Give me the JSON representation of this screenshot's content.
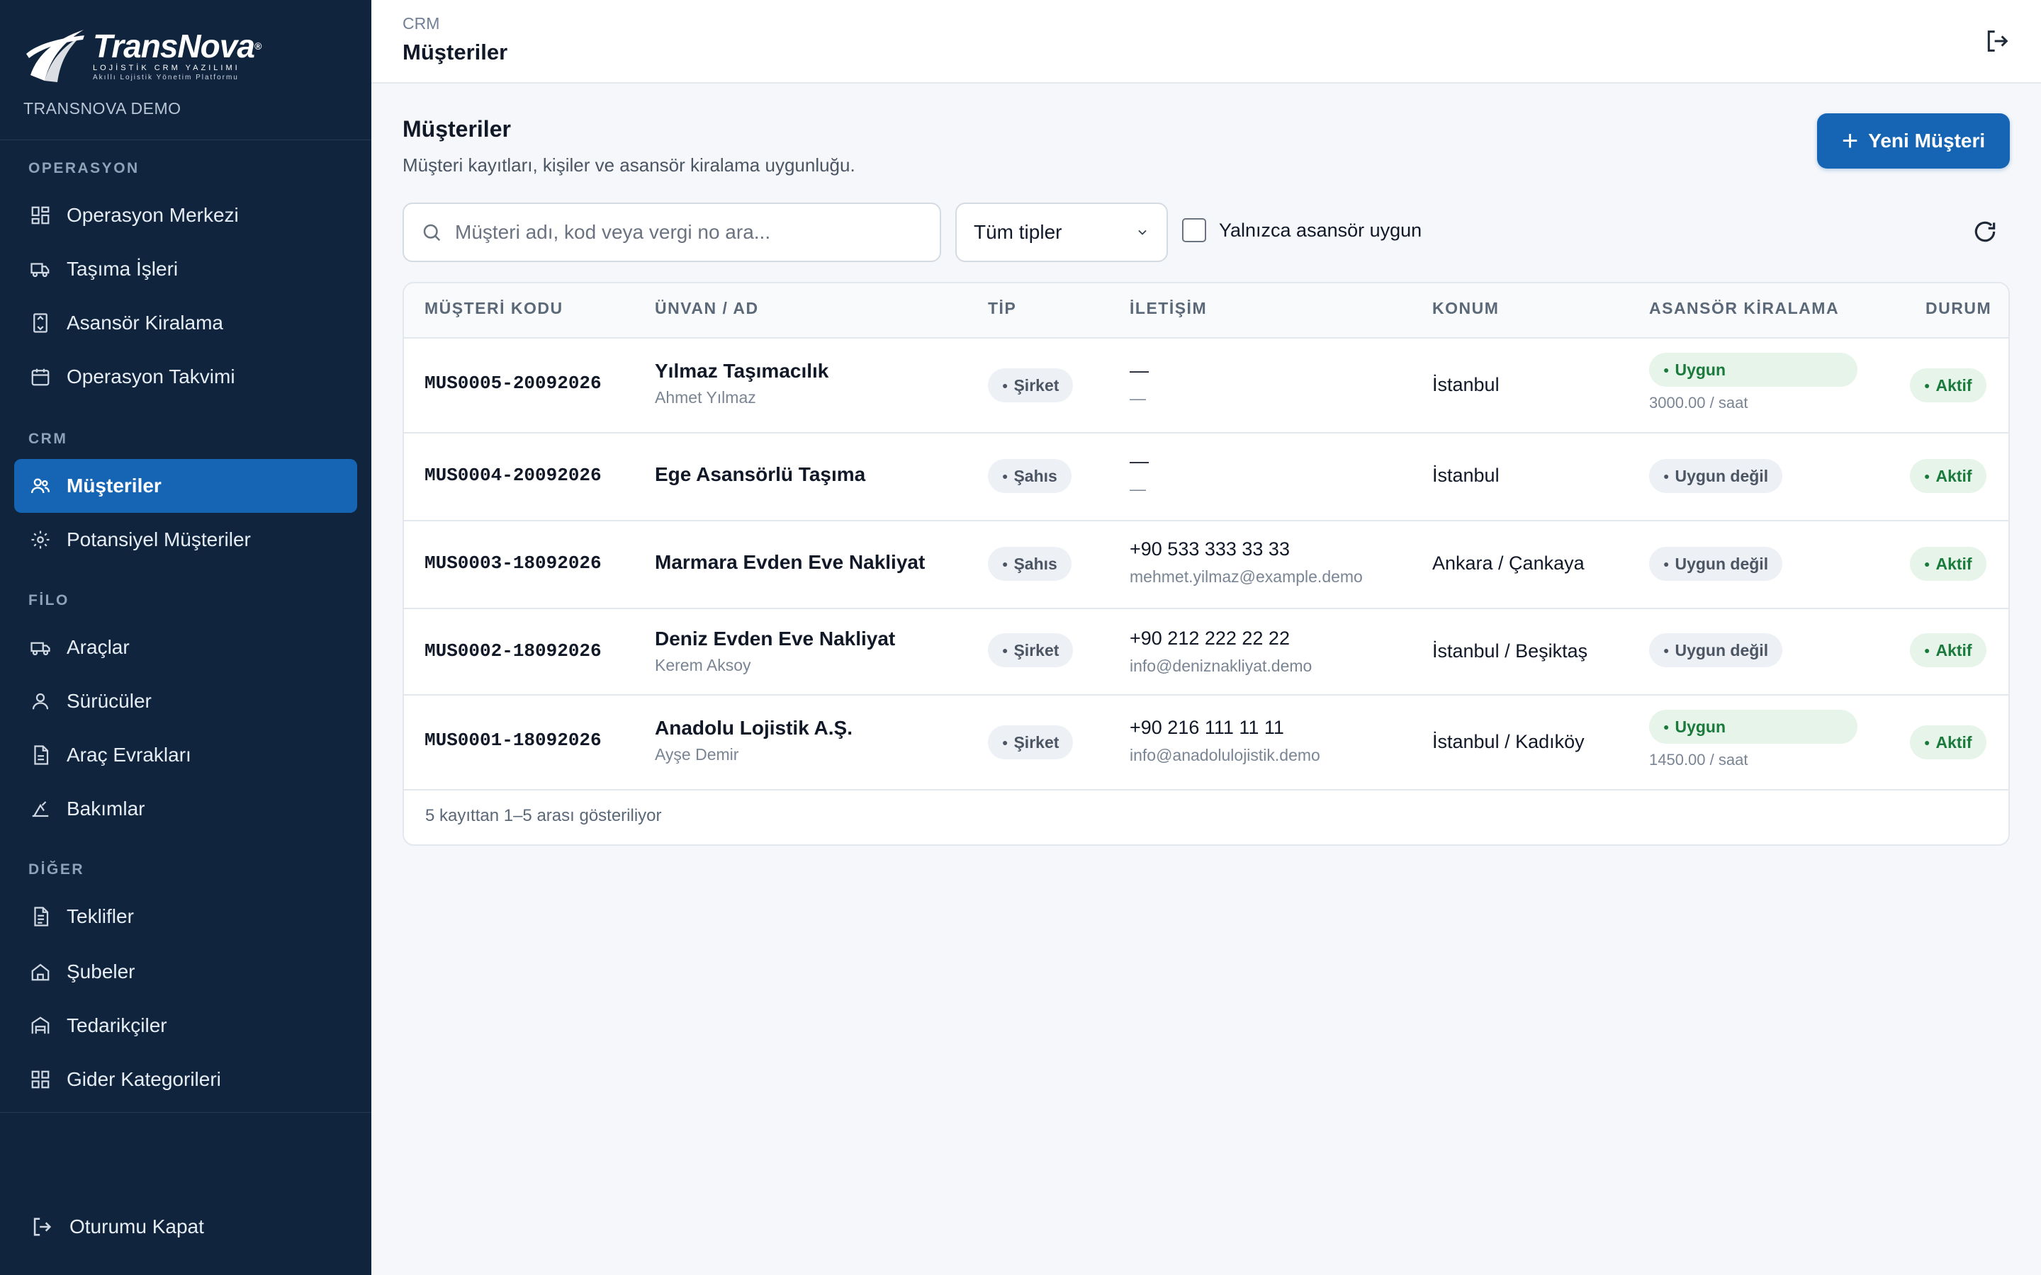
{
  "brand": {
    "name": "TransNova",
    "trademark": "®",
    "tagline1": "LOJİSTİK CRM YAZILIMI",
    "tagline2": "Akıllı Lojistik Yönetim Platformu",
    "tenant": "TRANSNOVA DEMO"
  },
  "sidebar": {
    "sections": [
      {
        "label": "OPERASYON"
      },
      {
        "label": "CRM"
      },
      {
        "label": "FİLO"
      },
      {
        "label": "DİĞER"
      }
    ],
    "items": [
      {
        "label": "Operasyon Merkezi",
        "icon": "dashboard-icon"
      },
      {
        "label": "Taşıma İşleri",
        "icon": "truck-icon"
      },
      {
        "label": "Asansör Kiralama",
        "icon": "elevator-icon"
      },
      {
        "label": "Operasyon Takvimi",
        "icon": "calendar-icon"
      },
      {
        "label": "Müşteriler",
        "icon": "users-icon",
        "active": true
      },
      {
        "label": "Potansiyel Müşteriler",
        "icon": "sparkle-icon"
      },
      {
        "label": "Araçlar",
        "icon": "vehicle-icon"
      },
      {
        "label": "Sürücüler",
        "icon": "user-icon"
      },
      {
        "label": "Araç Evrakları",
        "icon": "document-icon"
      },
      {
        "label": "Bakımlar",
        "icon": "maintenance-icon"
      },
      {
        "label": "Teklifler",
        "icon": "file-text-icon"
      },
      {
        "label": "Şubeler",
        "icon": "branch-icon"
      },
      {
        "label": "Tedarikçiler",
        "icon": "warehouse-icon"
      },
      {
        "label": "Gider Kategorileri",
        "icon": "grid-icon"
      }
    ],
    "logout_label": "Oturumu Kapat"
  },
  "header": {
    "breadcrumb": "CRM",
    "title": "Müşteriler"
  },
  "main": {
    "title": "Müşteriler",
    "subtitle": "Müşteri kayıtları, kişiler ve asansör kiralama uygunluğu.",
    "new_button": "Yeni Müşteri",
    "search_placeholder": "Müşteri adı, kod veya vergi no ara...",
    "type_filter": "Tüm tipler",
    "elevator_only_label": "Yalnızca asansör uygun",
    "columns": [
      "MÜŞTERİ KODU",
      "ÜNVAN / AD",
      "TİP",
      "İLETİŞİM",
      "KONUM",
      "ASANSÖR KİRALAMA",
      "DURUM"
    ],
    "rows": [
      {
        "code": "MUS0005-20092026",
        "name": "Yılmaz Taşımacılık",
        "contact_person": "Ahmet Yılmaz",
        "type": "Şirket",
        "phone": "—",
        "email": "—",
        "location": "İstanbul",
        "elevator": "Uygun",
        "elevator_ok": true,
        "rate": "3000.00 / saat",
        "status": "Aktif"
      },
      {
        "code": "MUS0004-20092026",
        "name": "Ege Asansörlü Taşıma",
        "contact_person": "",
        "type": "Şahıs",
        "phone": "—",
        "email": "—",
        "location": "İstanbul",
        "elevator": "Uygun değil",
        "elevator_ok": false,
        "rate": "",
        "status": "Aktif"
      },
      {
        "code": "MUS0003-18092026",
        "name": "Marmara Evden Eve Nakliyat",
        "contact_person": "",
        "type": "Şahıs",
        "phone": "+90 533 333 33 33",
        "email": "mehmet.yilmaz@example.demo",
        "location": "Ankara / Çankaya",
        "elevator": "Uygun değil",
        "elevator_ok": false,
        "rate": "",
        "status": "Aktif"
      },
      {
        "code": "MUS0002-18092026",
        "name": "Deniz Evden Eve Nakliyat",
        "contact_person": "Kerem Aksoy",
        "type": "Şirket",
        "phone": "+90 212 222 22 22",
        "email": "info@deniznakliyat.demo",
        "location": "İstanbul / Beşiktaş",
        "elevator": "Uygun değil",
        "elevator_ok": false,
        "rate": "",
        "status": "Aktif"
      },
      {
        "code": "MUS0001-18092026",
        "name": "Anadolu Lojistik A.Ş.",
        "contact_person": "Ayşe Demir",
        "type": "Şirket",
        "phone": "+90 216 111 11 11",
        "email": "info@anadolulojistik.demo",
        "location": "İstanbul / Kadıköy",
        "elevator": "Uygun",
        "elevator_ok": true,
        "rate": "1450.00 / saat",
        "status": "Aktif"
      }
    ],
    "footer": "5 kayıttan 1–5 arası gösteriliyor"
  },
  "colors": {
    "sidebar_bg": "#10243d",
    "accent": "#1565b4",
    "success": "#1a7a3c"
  }
}
